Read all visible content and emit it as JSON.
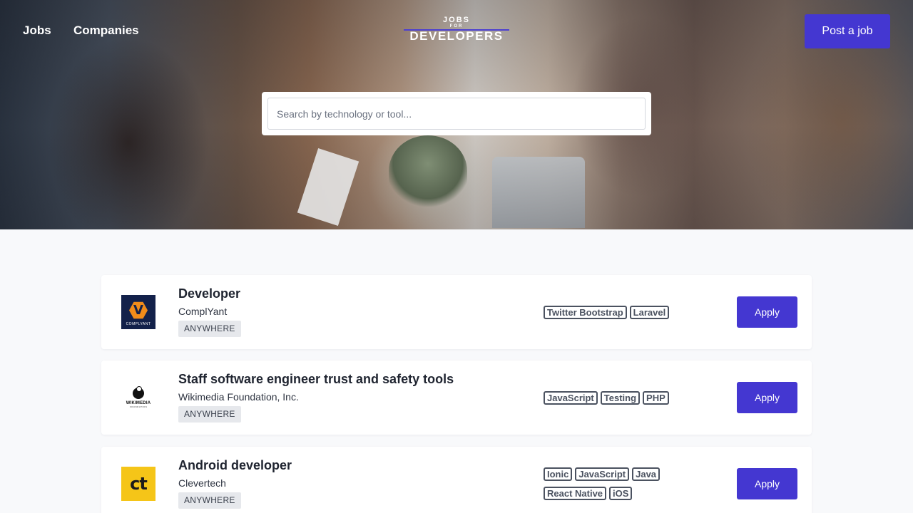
{
  "header": {
    "nav": [
      "Jobs",
      "Companies"
    ],
    "logo": {
      "line1": "JOBS",
      "line2": "FOR",
      "line3": "DEVELOPERS"
    },
    "post_job_label": "Post a job"
  },
  "search": {
    "placeholder": "Search by technology or tool...",
    "value": ""
  },
  "colors": {
    "accent": "#4437d1",
    "page_background": "#f8f9fb",
    "card_background": "#ffffff"
  },
  "jobs": [
    {
      "title": "Developer",
      "company": "ComplYant",
      "location": "ANYWHERE",
      "logo_icon": "complyant-logo-icon",
      "logo_text": "V",
      "logo_caption": "COMPLYANT",
      "tags": [
        "Twitter Bootstrap",
        "Laravel"
      ],
      "apply_label": "Apply"
    },
    {
      "title": "Staff software engineer trust and safety tools",
      "company": "Wikimedia Foundation, Inc.",
      "location": "ANYWHERE",
      "logo_icon": "wikimedia-logo-icon",
      "logo_caption": "WIKIMEDIA",
      "logo_subcaption": "FOUNDATION",
      "tags": [
        "JavaScript",
        "Testing",
        "PHP"
      ],
      "apply_label": "Apply"
    },
    {
      "title": "Android developer",
      "company": "Clevertech",
      "location": "ANYWHERE",
      "logo_icon": "clevertech-logo-icon",
      "logo_text": "ct",
      "tags": [
        "Ionic",
        "JavaScript",
        "Java",
        "React Native",
        "iOS"
      ],
      "apply_label": "Apply"
    }
  ]
}
